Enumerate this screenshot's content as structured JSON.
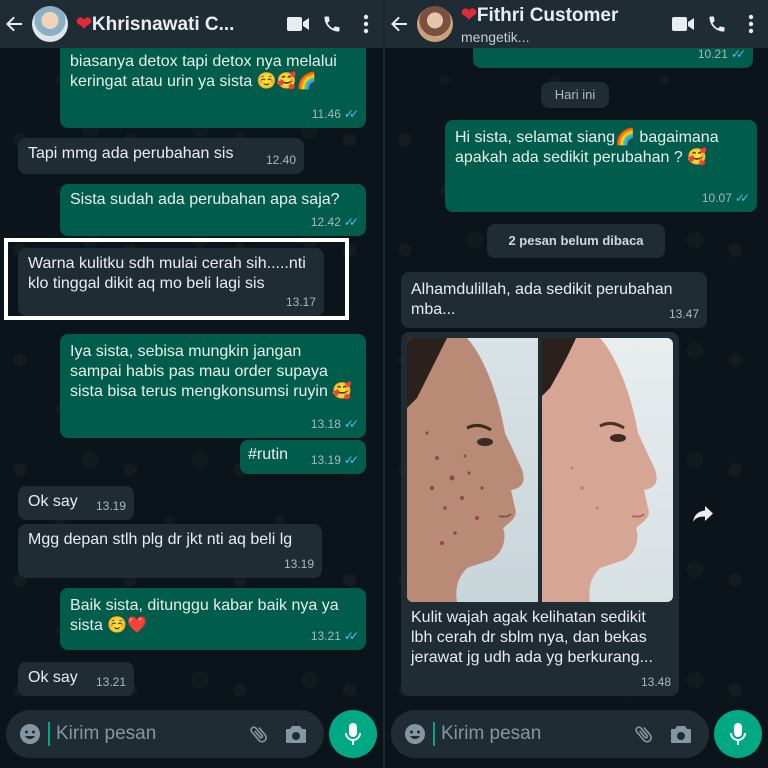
{
  "left_chat": {
    "contact_name": "Khrisnawati C...",
    "messages": [
      {
        "dir": "out",
        "text": "biasanya detox tapi detox nya melalui keringat atau urin ya sista ☺️🥰🌈",
        "time": "11.46"
      },
      {
        "dir": "in",
        "text": "Tapi mmg ada perubahan sis",
        "time": "12.40"
      },
      {
        "dir": "out",
        "text": "Sista sudah ada perubahan apa saja?",
        "time": "12.42"
      },
      {
        "dir": "in",
        "text": "Warna kulitku sdh mulai cerah sih.....nti klo tinggal dikit aq mo beli lagi sis",
        "time": "13.17"
      },
      {
        "dir": "out",
        "text": "Iya sista, sebisa mungkin jangan sampai habis pas mau order supaya sista bisa terus mengkonsumsi ruyin 🥰",
        "time": "13.18"
      },
      {
        "dir": "out",
        "text": "#rutin",
        "time": "13.19"
      },
      {
        "dir": "in",
        "text": "Ok say",
        "time": "13.19"
      },
      {
        "dir": "in",
        "text": "Mgg depan stlh plg dr jkt nti aq beli lg",
        "time": "13.19"
      },
      {
        "dir": "out",
        "text": "Baik sista, ditunggu kabar baik nya ya sista ☺️❤️",
        "time": "13.21"
      },
      {
        "dir": "in",
        "text": "Ok say",
        "time": "13.21"
      }
    ],
    "composer_placeholder": "Kirim pesan"
  },
  "right_chat": {
    "contact_name": "Fithri Customer",
    "status": "mengetik...",
    "top_time": "10.21",
    "date_label": "Hari ini",
    "unread_label": "2 pesan belum dibaca",
    "messages": [
      {
        "dir": "out",
        "text": "Hi sista, selamat siang🌈 bagaimana apakah ada sedikit perubahan ? 🥰",
        "time": "10.07"
      },
      {
        "dir": "in",
        "text": "Alhamdulillah, ada sedikit perubahan mba...",
        "time": "13.47"
      },
      {
        "dir": "in",
        "text": "Kulit wajah agak kelihatan sedikit lbh cerah dr sblm nya, dan bekas jerawat jg udh ada yg berkurang...",
        "time": "13.48"
      }
    ],
    "composer_placeholder": "Kirim pesan"
  },
  "icons": [
    "back-arrow-icon",
    "video-call-icon",
    "phone-icon",
    "more-options-icon",
    "emoji-icon",
    "attach-icon",
    "camera-icon",
    "mic-icon",
    "forward-icon",
    "double-check-icon"
  ],
  "colors": {
    "background": "#0b141a",
    "header": "#1f2c34",
    "incoming": "#1f2c34",
    "outgoing": "#005c4b",
    "accent": "#00a884",
    "read_ticks": "#53bdeb"
  }
}
